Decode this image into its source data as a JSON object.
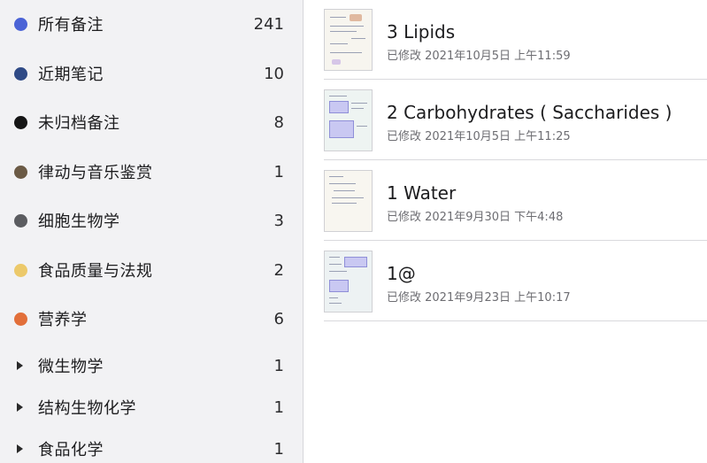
{
  "sidebar": {
    "categories": [
      {
        "label": "所有备注",
        "count": "241",
        "color": "#4b63d6",
        "marker": "dot"
      },
      {
        "label": "近期笔记",
        "count": "10",
        "color": "#2f4a86",
        "marker": "dot"
      },
      {
        "label": "未归档备注",
        "count": "8",
        "color": "#151515",
        "marker": "dot"
      },
      {
        "label": "律动与音乐鉴赏",
        "count": "1",
        "color": "#6b5a45",
        "marker": "dot"
      },
      {
        "label": "细胞生物学",
        "count": "3",
        "color": "#5b5c60",
        "marker": "dot"
      },
      {
        "label": "食品质量与法规",
        "count": "2",
        "color": "#ecc96a",
        "marker": "dot"
      },
      {
        "label": "营养学",
        "count": "6",
        "color": "#e26f3a",
        "marker": "dot"
      },
      {
        "label": "微生物学",
        "count": "1",
        "marker": "disclosure-triangle"
      },
      {
        "label": "结构生物化学",
        "count": "1",
        "marker": "disclosure-triangle"
      },
      {
        "label": "食品化学",
        "count": "1",
        "marker": "disclosure-triangle"
      }
    ]
  },
  "notes": [
    {
      "title": "3 Lipids",
      "meta": "已修改 2021年10月5日 上午11:59",
      "thumb_color": "#f7f5ef"
    },
    {
      "title": "2 Carbohydrates ( Saccharides )",
      "meta": "已修改 2021年10月5日 上午11:25",
      "thumb_color": "#eef4f2"
    },
    {
      "title": "1 Water",
      "meta": "已修改 2021年9月30日 下午4:48",
      "thumb_color": "#f8f6f0"
    },
    {
      "title": "1@",
      "meta": "已修改 2021年9月23日 上午10:17",
      "thumb_color": "#edf2f3"
    }
  ]
}
